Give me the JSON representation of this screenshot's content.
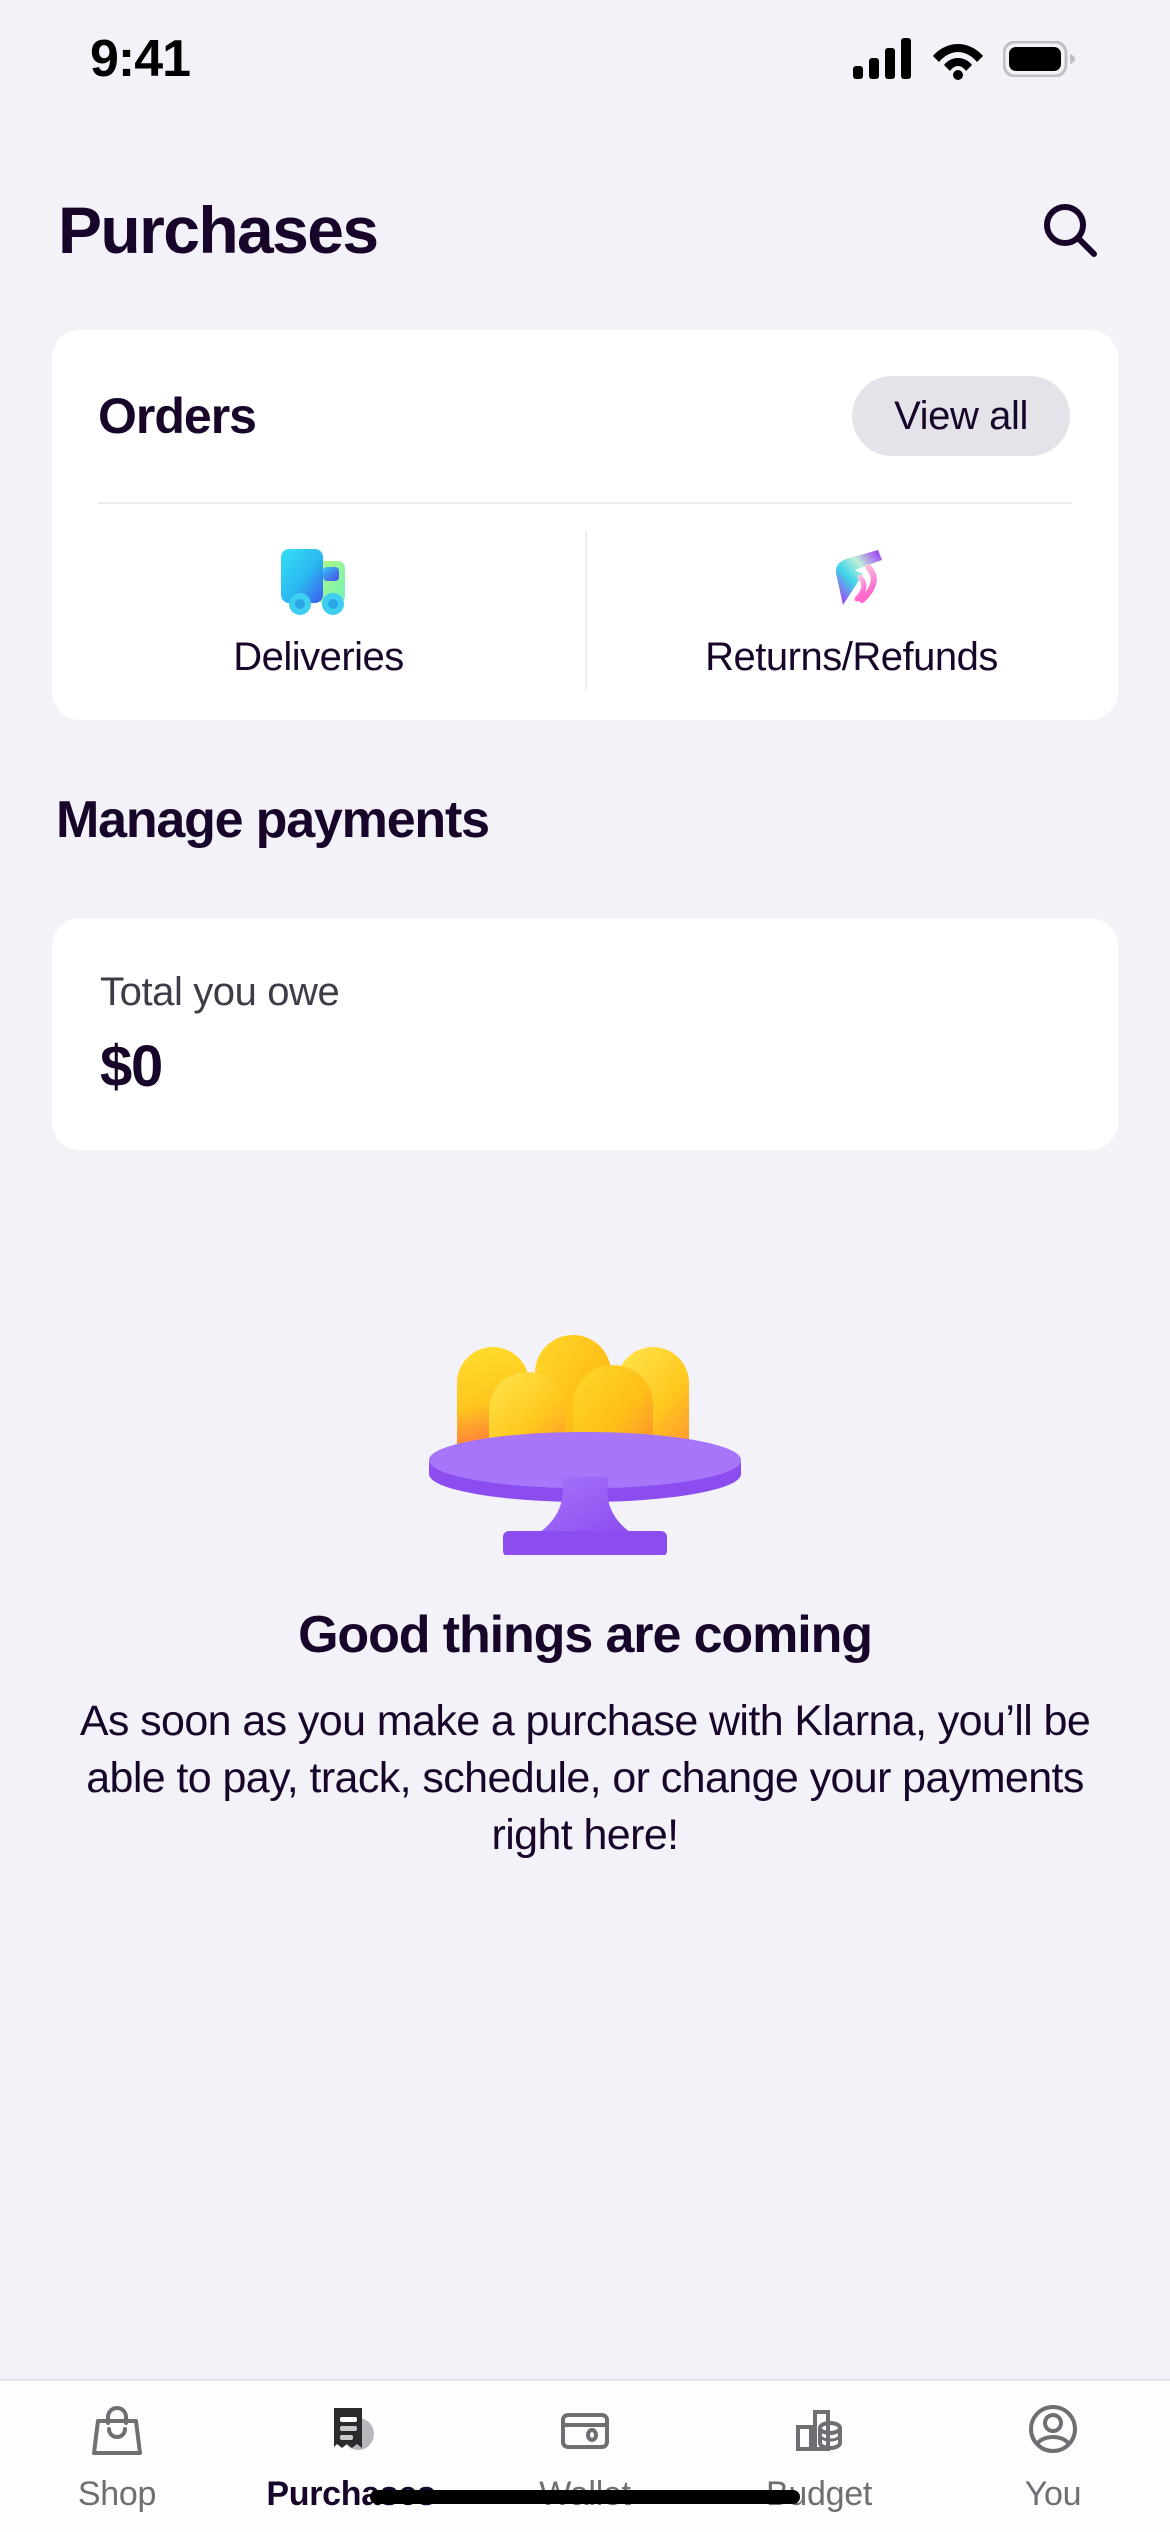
{
  "status_bar": {
    "time": "9:41",
    "icons": [
      "cellular-signal-icon",
      "wifi-icon",
      "battery-icon"
    ]
  },
  "header": {
    "title": "Purchases",
    "search_icon": "search-icon"
  },
  "orders_card": {
    "title": "Orders",
    "view_all_label": "View all",
    "tiles": [
      {
        "label": "Deliveries",
        "icon": "delivery-truck-icon"
      },
      {
        "label": "Returns/Refunds",
        "icon": "boomerang-return-icon"
      }
    ]
  },
  "manage_payments": {
    "heading": "Manage payments",
    "total_label": "Total you owe",
    "total_amount": "$0"
  },
  "empty_state": {
    "illustration": "jelly-pudding-on-stand-icon",
    "title": "Good things are coming",
    "body": "As soon as you make a purchase with Klarna, you’ll be able to pay, track, schedule, or change your payments right here!"
  },
  "tab_bar": {
    "active": "Purchases",
    "tabs": [
      {
        "label": "Shop",
        "icon": "shopping-bag-icon"
      },
      {
        "label": "Purchases",
        "icon": "receipt-icon"
      },
      {
        "label": "Wallet",
        "icon": "wallet-icon"
      },
      {
        "label": "Budget",
        "icon": "bar-chart-coins-icon"
      },
      {
        "label": "You",
        "icon": "person-circle-icon"
      }
    ]
  },
  "colors": {
    "background": "#F3F2F8",
    "card": "#FFFFFF",
    "text_primary": "#17062A",
    "text_muted": "#6E6E73",
    "pill_background": "#E4E3EA",
    "divider": "#EDECF1",
    "jelly_yellow": "#FFD21E",
    "jelly_orange": "#FF8A3D",
    "stand_purple": "#9B5CF6",
    "truck_cyan": "#2BD9F0",
    "truck_blue": "#3D5AF1",
    "truck_green": "#8CF2A8",
    "boomerang_purple": "#9B4DF0",
    "boomerang_pink": "#FF6FD8"
  }
}
